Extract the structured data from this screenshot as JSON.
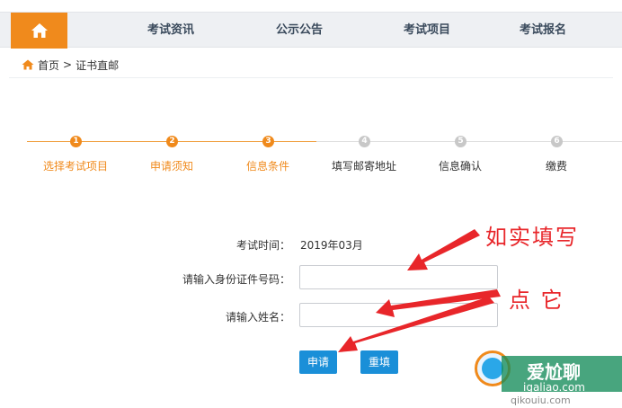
{
  "nav": {
    "items": [
      "考试资讯",
      "公示公告",
      "考试项目",
      "考试报名"
    ]
  },
  "breadcrumb": {
    "home": "首页",
    "separator": ">",
    "current": "证书直邮"
  },
  "steps": [
    {
      "num": "1",
      "label": "选择考试项目",
      "state": "done"
    },
    {
      "num": "2",
      "label": "申请须知",
      "state": "done"
    },
    {
      "num": "3",
      "label": "信息条件",
      "state": "done"
    },
    {
      "num": "4",
      "label": "填写邮寄地址",
      "state": "todo"
    },
    {
      "num": "5",
      "label": "信息确认",
      "state": "todo"
    },
    {
      "num": "6",
      "label": "缴费",
      "state": "todo"
    }
  ],
  "form": {
    "exam_time_label": "考试时间：",
    "exam_time_value": "2019年03月",
    "id_label": "请输入身份证件号码：",
    "id_value": "",
    "name_label": "请输入姓名：",
    "name_value": "",
    "apply_label": "申请",
    "reset_label": "重填"
  },
  "annotations": {
    "fill_truthfully": "如实填写",
    "click_it": "点 它"
  },
  "watermark": {
    "brand": "爱尬聊",
    "url": "igaliao.com",
    "sub": "qikouiu.com"
  },
  "colors": {
    "accent_orange": "#f08a1c",
    "button_blue": "#1a8fd8",
    "annotation_red": "#e8262a",
    "step_todo_gray": "#c8c8c8"
  }
}
